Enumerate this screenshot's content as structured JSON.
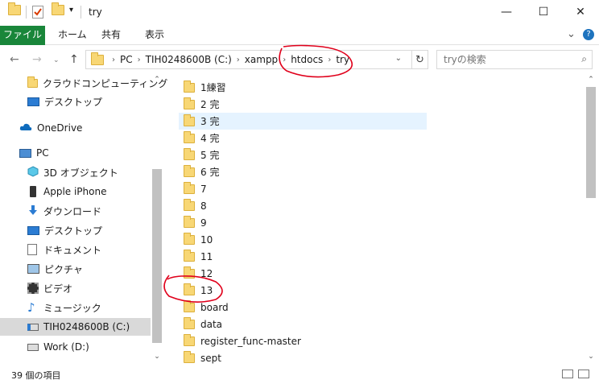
{
  "window": {
    "title": "try",
    "minimize": "—",
    "maximize": "☐",
    "close": "✕"
  },
  "ribbon": {
    "tabs": [
      "ファイル",
      "ホーム",
      "共有",
      "表示"
    ],
    "expand": "⌄",
    "help": "?"
  },
  "address": {
    "crumbs": [
      "PC",
      "TIH0248600B (C:)",
      "xampp",
      "htdocs",
      "try"
    ]
  },
  "search": {
    "placeholder": "tryの検索"
  },
  "sidebar": {
    "items": [
      {
        "label": "クラウドコンピューティング",
        "icon": "folder-icon"
      },
      {
        "label": "デスクトップ",
        "icon": "desktop-icon"
      },
      {
        "label": "OneDrive",
        "icon": "cloud-icon"
      },
      {
        "label": "PC",
        "icon": "pc-icon"
      },
      {
        "label": "3D オブジェクト",
        "icon": "cube-icon"
      },
      {
        "label": "Apple iPhone",
        "icon": "phone-icon"
      },
      {
        "label": "ダウンロード",
        "icon": "download-icon"
      },
      {
        "label": "デスクトップ",
        "icon": "desktop-icon"
      },
      {
        "label": "ドキュメント",
        "icon": "document-icon"
      },
      {
        "label": "ピクチャ",
        "icon": "picture-icon"
      },
      {
        "label": "ビデオ",
        "icon": "video-icon"
      },
      {
        "label": "ミュージック",
        "icon": "music-icon"
      },
      {
        "label": "TIH0248600B (C:)",
        "icon": "drive-icon"
      },
      {
        "label": "Work (D:)",
        "icon": "drive-icon"
      }
    ]
  },
  "files": [
    "1練習",
    "2 完",
    "3 完",
    "4 完",
    "5 完",
    "6 完",
    "7",
    "8",
    "9",
    "10",
    "11",
    "12",
    "13",
    "board",
    "data",
    "register_func-master",
    "sept"
  ],
  "status": {
    "count": "39 個の項目"
  },
  "colors": {
    "file_tab": "#19863a",
    "annotation": "#e0001b",
    "hover": "#e5f3ff",
    "selected": "#d9d9d9"
  }
}
